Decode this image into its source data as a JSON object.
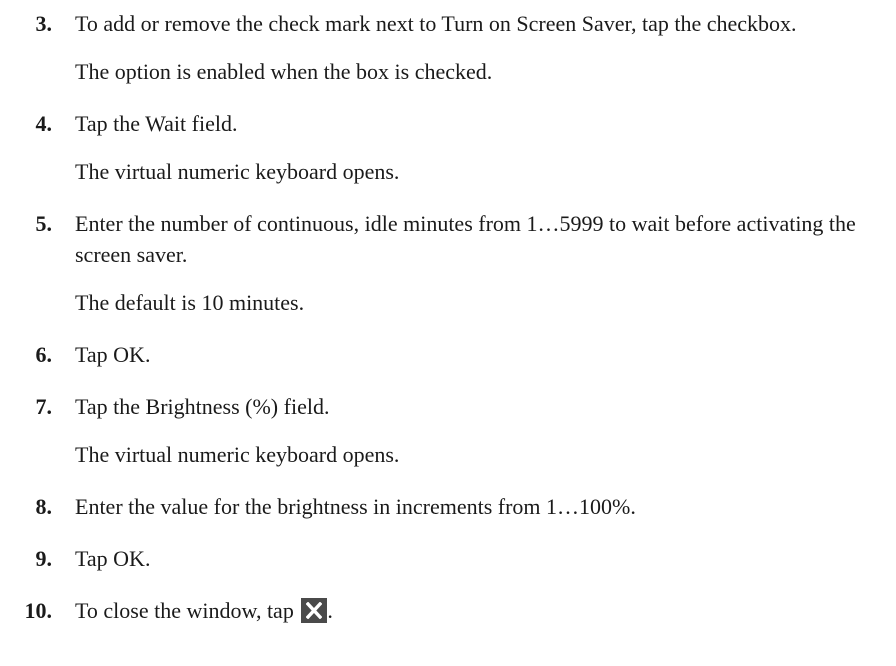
{
  "steps": [
    {
      "number": "3.",
      "text": "To add or remove the check mark next to Turn on Screen Saver, tap the checkbox.",
      "result": "The option is enabled when the box is checked."
    },
    {
      "number": "4.",
      "text": "Tap the Wait field.",
      "result": "The virtual numeric keyboard opens."
    },
    {
      "number": "5.",
      "text": "Enter the number of continuous, idle minutes from 1…5999 to wait before activating the screen saver.",
      "result": "The default is 10 minutes."
    },
    {
      "number": "6.",
      "text": "Tap OK."
    },
    {
      "number": "7.",
      "text": "Tap the Brightness (%) field.",
      "result": "The virtual numeric keyboard opens."
    },
    {
      "number": "8.",
      "text": "Enter the value for the brightness in increments from 1…100%."
    },
    {
      "number": "9.",
      "text": "Tap OK."
    },
    {
      "number": "10.",
      "text_before_icon": "To close the window, tap",
      "icon": "close-icon",
      "text_after_icon": "."
    }
  ]
}
